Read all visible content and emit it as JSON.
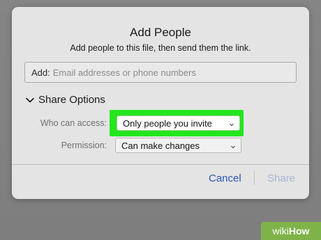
{
  "dialog": {
    "title": "Add People",
    "subtitle": "Add people to this file, then send them the link."
  },
  "add_field": {
    "label": "Add:",
    "placeholder": "Email addresses or phone numbers"
  },
  "share_options": {
    "label": "Share Options",
    "who_can_access": {
      "label": "Who can access:",
      "value": "Only people you invite"
    },
    "permission": {
      "label": "Permission:",
      "value": "Can make changes"
    }
  },
  "buttons": {
    "cancel": "Cancel",
    "share": "Share"
  },
  "watermark": {
    "part1": "wiki",
    "part2": "How"
  },
  "colors": {
    "highlight": "#24e61d",
    "link_blue": "#2b56b8",
    "disabled_blue": "#a6b6d6"
  },
  "icons": {
    "disclosure": "chevron-down-icon",
    "select_caret": "up-down-caret-icon"
  }
}
